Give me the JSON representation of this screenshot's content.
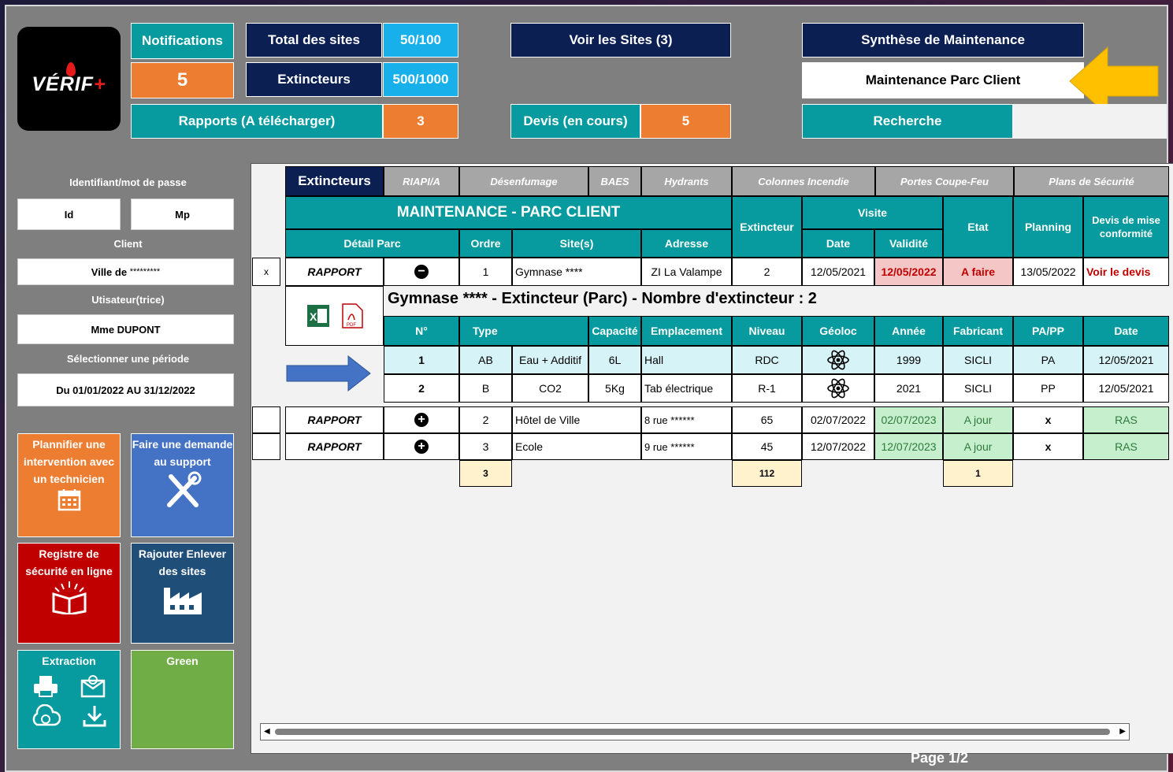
{
  "header": {
    "logo_text": "VÉRIF",
    "logo_plus": "+",
    "notifications_label": "Notifications",
    "notifications_count": "5",
    "total_sites_label": "Total des sites",
    "total_sites_value": "50/100",
    "extincteurs_label": "Extincteurs",
    "extincteurs_value": "500/1000",
    "voir_sites_label": "Voir les Sites (3)",
    "synthese_label": "Synthèse de Maintenance",
    "maintenance_parc_label": "Maintenance Parc Client",
    "rapports_label": "Rapports (A télécharger)",
    "rapports_value": "3",
    "devis_label": "Devis (en cours)",
    "devis_value": "5",
    "recherche_label": "Recherche"
  },
  "sidebar": {
    "login_label": "Identifiant/mot de passe",
    "id_value": "Id",
    "mp_value": "Mp",
    "client_label": "Client",
    "client_value_prefix": "Ville de",
    "client_value_mask": "*********",
    "user_label": "Utisateur(trice)",
    "user_value": "Mme DUPONT",
    "period_label": "Sélectionner une période",
    "period_value": "Du 01/01/2022 AU 31/12/2022",
    "actions": {
      "plan": "Plannifier une intervention avec un technicien",
      "support": "Faire une demande au support",
      "registre": "Registre de sécurité en ligne",
      "sites": "Rajouter Enlever des sites",
      "extraction": "Extraction",
      "green": "Green"
    }
  },
  "tabs": [
    "Extincteurs",
    "RIAPI/A",
    "Désenfumage",
    "BAES",
    "Hydrants",
    "Colonnes Incendie",
    "Portes Coupe-Feu",
    "Plans de Sécurité"
  ],
  "table": {
    "title": "MAINTENANCE - PARC CLIENT",
    "headers": {
      "detail": "Détail Parc",
      "ordre": "Ordre",
      "sites": "Site(s)",
      "adresse": "Adresse",
      "extincteur": "Extincteur",
      "visite": "Visite",
      "date": "Date",
      "validite": "Validité",
      "etat": "Etat",
      "planning": "Planning",
      "devis": "Devis de mise conformité"
    },
    "rows": [
      {
        "check": "x",
        "rapport": "RAPPORT",
        "ordre": "1",
        "site": "Gymnase ****",
        "adresse": "ZI La Valampe",
        "ext": "2",
        "date": "12/05/2021",
        "validite": "12/05/2022",
        "etat": "A faire",
        "planning": "13/05/2022",
        "devis": "Voir le devis"
      },
      {
        "check": "",
        "rapport": "RAPPORT",
        "ordre": "2",
        "site": "Hôtel de Ville",
        "adresse": "8 rue ******",
        "ext": "65",
        "date": "02/07/2022",
        "validite": "02/07/2023",
        "etat": "A jour",
        "planning": "x",
        "devis": "RAS"
      },
      {
        "check": "",
        "rapport": "RAPPORT",
        "ordre": "3",
        "site": "Ecole",
        "adresse": "9 rue ******",
        "ext": "45",
        "date": "12/07/2022",
        "validite": "12/07/2023",
        "etat": "A jour",
        "planning": "x",
        "devis": "RAS"
      }
    ],
    "totals": {
      "ordre": "3",
      "ext": "112",
      "etat": "1"
    },
    "detail": {
      "title": "Gymnase **** - Extincteur (Parc) - Nombre d'extincteur : 2",
      "headers": {
        "num": "N°",
        "type": "Type",
        "capacite": "Capacité",
        "emplacement": "Emplacement",
        "niveau": "Niveau",
        "geoloc": "Géoloc",
        "annee": "Année",
        "fabricant": "Fabricant",
        "papp": "PA/PP",
        "date": "Date"
      },
      "rows": [
        {
          "num": "1",
          "type": "AB",
          "agent": "Eau + Additif",
          "capacite": "6L",
          "emplacement": "Hall",
          "niveau": "RDC",
          "annee": "1999",
          "fabricant": "SICLI",
          "papp": "PA",
          "date": "12/05/2021"
        },
        {
          "num": "2",
          "type": "B",
          "agent": "CO2",
          "capacite": "5Kg",
          "emplacement": "Tab électrique",
          "niveau": "R-1",
          "annee": "2021",
          "fabricant": "SICLI",
          "papp": "PP",
          "date": "12/05/2021"
        }
      ]
    }
  },
  "footer": {
    "page": "Page 1/2"
  },
  "colors": {
    "navy": "#0b1f53",
    "teal": "#079a9e",
    "orange": "#ed7d31",
    "sky": "#17b0eb",
    "red": "#c00000",
    "blue": "#4472c4",
    "green": "#70ad47",
    "arrow": "#ffc000"
  }
}
